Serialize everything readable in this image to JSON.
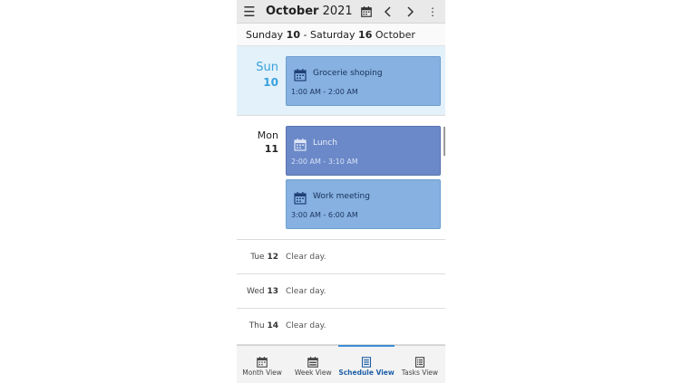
{
  "toolbar": {
    "menu_icon": "hamburger-menu-icon",
    "title_month": "October",
    "title_year": "2021",
    "calendar_icon": "calendar-icon",
    "prev_icon": "chevron-left-icon",
    "next_icon": "chevron-right-icon",
    "more_icon": "more-vertical-icon"
  },
  "week_range": {
    "start_day": "Sunday",
    "start_date": "10",
    "separator": "-",
    "end_day": "Saturday",
    "end_date": "16",
    "month": "October"
  },
  "days": [
    {
      "name": "Sun",
      "number": "10",
      "highlighted": true,
      "events": [
        {
          "title": "Grocerie shoping",
          "time": "1:00 AM - 2:00 AM",
          "icon": "calendar-event-icon"
        }
      ]
    },
    {
      "name": "Mon",
      "number": "11",
      "highlighted": false,
      "events": [
        {
          "title": "Lunch",
          "time": "2:00 AM - 3:10 AM",
          "icon": "calendar-event-icon"
        },
        {
          "title": "Work meeting",
          "time": "3:00 AM - 6:00 AM",
          "icon": "calendar-event-icon"
        }
      ]
    }
  ],
  "clear_days": [
    {
      "name": "Tue",
      "number": "12",
      "text": "Clear day."
    },
    {
      "name": "Wed",
      "number": "13",
      "text": "Clear day."
    },
    {
      "name": "Thu",
      "number": "14",
      "text": "Clear day."
    }
  ],
  "bottom_nav": [
    {
      "label": "Month View",
      "icon": "month-calendar-icon",
      "active": false
    },
    {
      "label": "Week View",
      "icon": "week-calendar-icon",
      "active": false
    },
    {
      "label": "Schedule View",
      "icon": "schedule-list-icon",
      "active": true
    },
    {
      "label": "Tasks View",
      "icon": "tasks-list-icon",
      "active": false
    }
  ],
  "colors": {
    "accent": "#38a1dc",
    "event_light": "#86b1e0",
    "event_dark": "#6b89c8",
    "highlight_bg": "#e3f1fa",
    "active_nav": "#1f5fa8"
  }
}
